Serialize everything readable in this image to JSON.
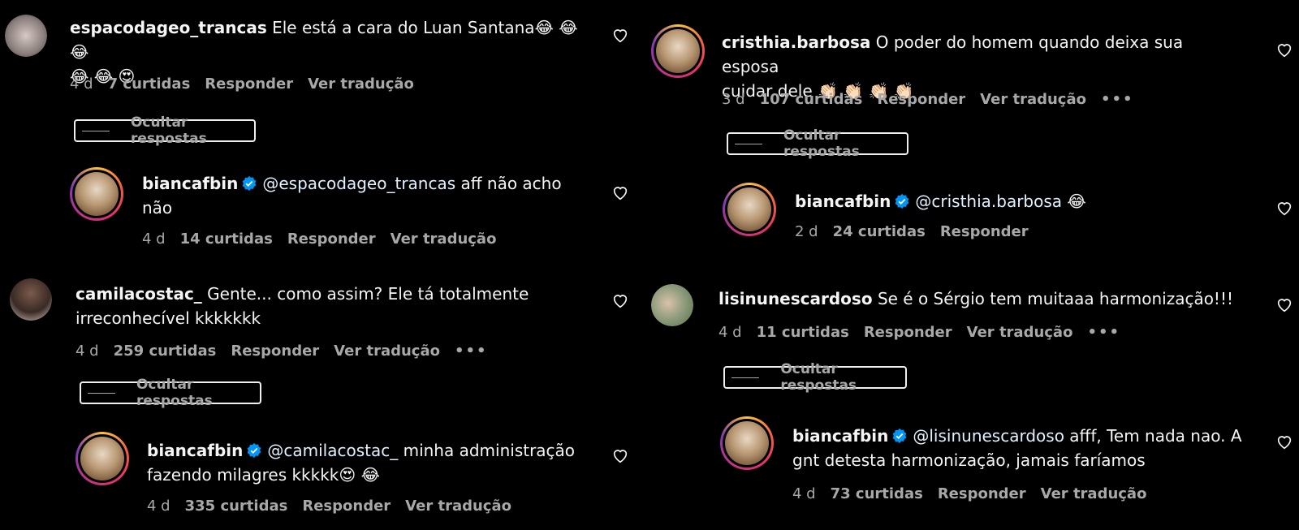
{
  "left": [
    {
      "username": "espacodageo_trancas",
      "text_line1": "Ele está a cara do Luan Santana😂 😂 😂",
      "text_line2": "😂 😂 😍",
      "time": "4 d",
      "likes": "7 curtidas",
      "reply": "Responder",
      "translate": "Ver tradução",
      "hide_replies": "Ocultar respostas",
      "reply_item": {
        "username": "biancafbin",
        "mention": "@espacodageo_trancas",
        "text_line1": " aff não acho",
        "text_line2": "não",
        "time": "4 d",
        "likes": "14 curtidas",
        "reply": "Responder",
        "translate": "Ver tradução"
      }
    },
    {
      "username": "camilacostac_",
      "text_line1": "Gente... como assim? Ele tá totalmente",
      "text_line2": "irreconhecível kkkkkkk",
      "time": "4 d",
      "likes": "259 curtidas",
      "reply": "Responder",
      "translate": "Ver tradução",
      "more": "•••",
      "hide_replies": "Ocultar respostas",
      "reply_item": {
        "username": "biancafbin",
        "mention": "@camilacostac_",
        "text_line1": " minha administração",
        "text_line2": "fazendo milagres kkkkk😍 😂",
        "time": "4 d",
        "likes": "335 curtidas",
        "reply": "Responder",
        "translate": "Ver tradução"
      }
    }
  ],
  "right": [
    {
      "username": "cristhia.barbosa",
      "text_line1": "O poder do homem quando deixa sua esposa",
      "text_line2": "cuidar dele 👏🏻 👏🏻 👏🏻 👏🏻",
      "time": "3 d",
      "likes": "107 curtidas",
      "reply": "Responder",
      "translate": "Ver tradução",
      "more": "•••",
      "hide_replies": "Ocultar respostas",
      "reply_item": {
        "username": "biancafbin",
        "mention": "@cristhia.barbosa",
        "text_line1": " 😂",
        "time": "2 d",
        "likes": "24 curtidas",
        "reply": "Responder"
      }
    },
    {
      "username": "lisinunescardoso",
      "text_line1": "Se é o Sérgio tem muitaaa harmonização!!!",
      "time": "4 d",
      "likes": "11 curtidas",
      "reply": "Responder",
      "translate": "Ver tradução",
      "more": "•••",
      "hide_replies": "Ocultar respostas",
      "reply_item": {
        "username": "biancafbin",
        "mention": "@lisinunescardoso",
        "text_line1": " afff, Tem nada nao. A",
        "text_line2": "gnt detesta harmonização, jamais faríamos",
        "time": "4 d",
        "likes": "73 curtidas",
        "reply": "Responder",
        "translate": "Ver tradução"
      }
    }
  ],
  "colors": {
    "background": "#000000",
    "text": "#f5f5f5",
    "meta": "#a8a8a8",
    "verified": "#0095f6"
  }
}
